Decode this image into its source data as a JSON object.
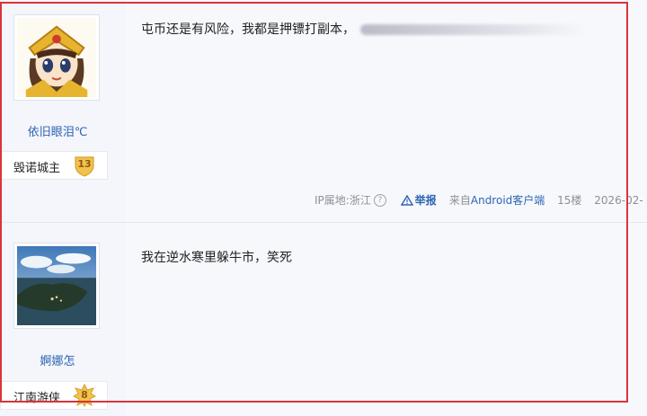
{
  "posts": [
    {
      "username": "依旧眼泪℃",
      "level_title": "毁诺城主",
      "level": "13",
      "text": "屯币还是有风险，我都是押镖打副本，",
      "meta": {
        "ip_location": "IP属地:浙江",
        "report": "举报",
        "source_prefix": "来自",
        "source_app": "Android客户端",
        "floor": "15楼",
        "date": "2026-02-"
      }
    },
    {
      "username": "婀娜怎",
      "level_title": "江南游侠",
      "level": "8",
      "text": "我在逆水寒里躲牛市，笑死"
    }
  ],
  "icons": {
    "help": "question-circle-icon",
    "report": "warning-triangle-icon"
  },
  "colors": {
    "link": "#2d64b3",
    "frame": "#d9343a",
    "badge": "#f2c14e"
  }
}
